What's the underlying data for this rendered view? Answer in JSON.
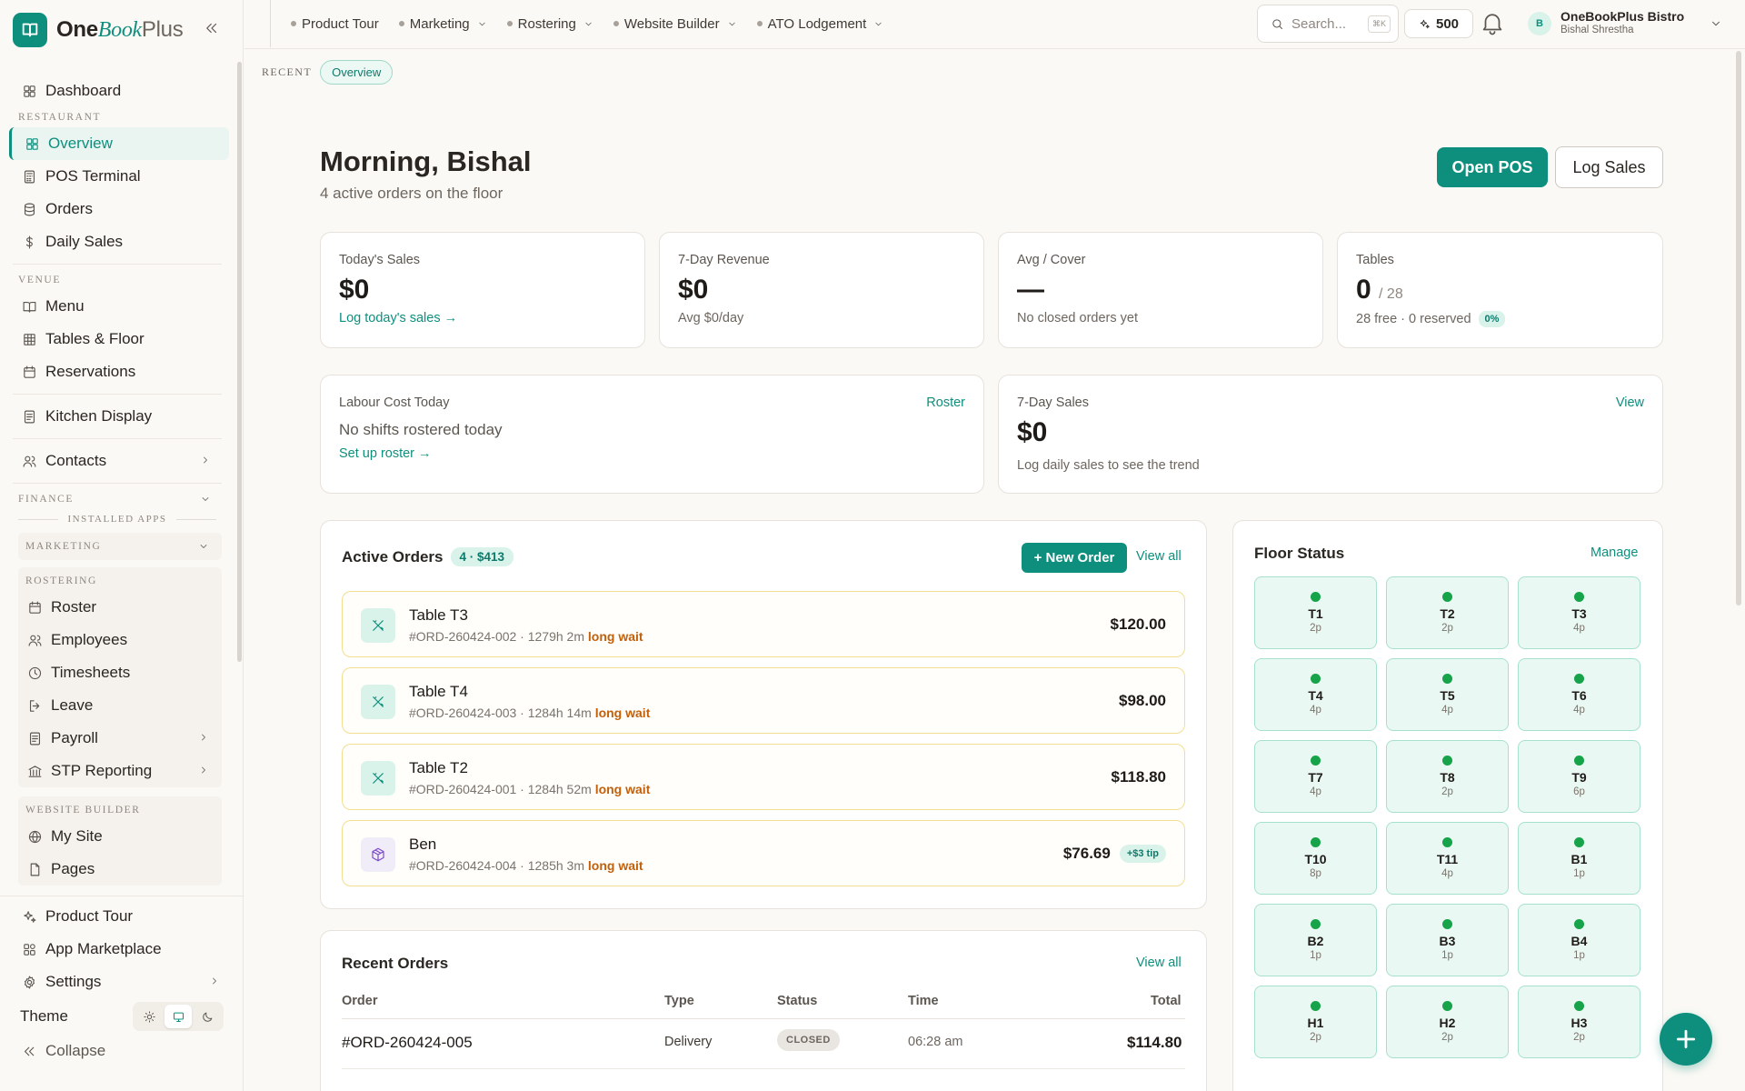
{
  "brand": {
    "one": "One",
    "book": "Book",
    "plus": "Plus"
  },
  "sidebar": {
    "dashboard": "Dashboard",
    "restaurant_label": "RESTAURANT",
    "overview": "Overview",
    "pos_terminal": "POS Terminal",
    "orders": "Orders",
    "daily_sales": "Daily Sales",
    "venue_label": "VENUE",
    "menu": "Menu",
    "tables_floor": "Tables & Floor",
    "reservations": "Reservations",
    "kitchen_display": "Kitchen Display",
    "contacts": "Contacts",
    "finance_label": "FINANCE",
    "installed_apps_label": "INSTALLED APPS",
    "marketing_label": "MARKETING",
    "rostering_label": "ROSTERING",
    "roster": "Roster",
    "employees": "Employees",
    "timesheets": "Timesheets",
    "leave": "Leave",
    "payroll": "Payroll",
    "stp_reporting": "STP Reporting",
    "website_builder_label": "WEBSITE BUILDER",
    "my_site": "My Site",
    "pages": "Pages",
    "product_tour": "Product Tour",
    "app_marketplace": "App Marketplace",
    "settings": "Settings",
    "theme": "Theme",
    "collapse": "Collapse"
  },
  "topnav": [
    "Product Tour",
    "Marketing",
    "Rostering",
    "Website Builder",
    "ATO Lodgement"
  ],
  "search": {
    "placeholder": "Search...",
    "shortcut": "⌘K"
  },
  "credits": "500",
  "user": {
    "initial": "B",
    "business": "OneBookPlus Bistro",
    "name": "Bishal Shrestha"
  },
  "recent": {
    "label": "RECENT",
    "chip": "Overview"
  },
  "greeting": {
    "title": "Morning, Bishal",
    "subtitle": "4 active orders on the floor"
  },
  "actions": {
    "open_pos": "Open POS",
    "log_sales": "Log Sales"
  },
  "kpis": {
    "today_sales": {
      "label": "Today's Sales",
      "value": "$0",
      "link": "Log today's sales →"
    },
    "revenue_7d": {
      "label": "7-Day Revenue",
      "value": "$0",
      "sub": "Avg $0/day"
    },
    "avg_cover": {
      "label": "Avg / Cover",
      "value": "—",
      "sub": "No closed orders yet"
    },
    "tables": {
      "label": "Tables",
      "value": "0",
      "total": "/ 28",
      "sub": "28 free · 0 reserved",
      "pct": "0%"
    }
  },
  "labour": {
    "label": "Labour Cost Today",
    "link": "Roster",
    "text": "No shifts rostered today",
    "cta": "Set up roster →"
  },
  "sales7": {
    "label": "7-Day Sales",
    "link": "View",
    "value": "$0",
    "sub": "Log daily sales to see the trend"
  },
  "active_orders": {
    "title": "Active Orders",
    "badge": "4 · $413",
    "new_order": "+ New Order",
    "view_all": "View all",
    "items": [
      {
        "name": "Table T3",
        "meta": "#ORD-260424-002 · 1279h 2m",
        "wait": "long wait",
        "total": "$120.00",
        "tip": ""
      },
      {
        "name": "Table T4",
        "meta": "#ORD-260424-003 · 1284h 14m",
        "wait": "long wait",
        "total": "$98.00",
        "tip": ""
      },
      {
        "name": "Table T2",
        "meta": "#ORD-260424-001 · 1284h 52m",
        "wait": "long wait",
        "total": "$118.80",
        "tip": ""
      },
      {
        "name": "Ben",
        "meta": "#ORD-260424-004 · 1285h 3m",
        "wait": "long wait",
        "total": "$76.69",
        "tip": "+$3 tip"
      }
    ]
  },
  "recent_orders": {
    "title": "Recent Orders",
    "view_all": "View all",
    "columns": [
      "Order",
      "Type",
      "Status",
      "Time",
      "Total"
    ],
    "rows": [
      {
        "order": "#ORD-260424-005",
        "type": "Delivery",
        "status": "CLOSED",
        "time": "06:28 am",
        "total": "$114.80"
      }
    ]
  },
  "floor": {
    "title": "Floor Status",
    "manage": "Manage",
    "tables": [
      {
        "name": "T1",
        "cap": "2p"
      },
      {
        "name": "T2",
        "cap": "2p"
      },
      {
        "name": "T3",
        "cap": "4p"
      },
      {
        "name": "T4",
        "cap": "4p"
      },
      {
        "name": "T5",
        "cap": "4p"
      },
      {
        "name": "T6",
        "cap": "4p"
      },
      {
        "name": "T7",
        "cap": "4p"
      },
      {
        "name": "T8",
        "cap": "2p"
      },
      {
        "name": "T9",
        "cap": "6p"
      },
      {
        "name": "T10",
        "cap": "8p"
      },
      {
        "name": "T11",
        "cap": "4p"
      },
      {
        "name": "B1",
        "cap": "1p"
      },
      {
        "name": "B2",
        "cap": "1p"
      },
      {
        "name": "B3",
        "cap": "1p"
      },
      {
        "name": "B4",
        "cap": "1p"
      },
      {
        "name": "H1",
        "cap": "2p"
      },
      {
        "name": "H2",
        "cap": "2p"
      },
      {
        "name": "H3",
        "cap": "2p"
      }
    ]
  },
  "colors": {
    "accent": "#0e8f7e",
    "warning": "#c2600c",
    "available": "#16a34a"
  }
}
